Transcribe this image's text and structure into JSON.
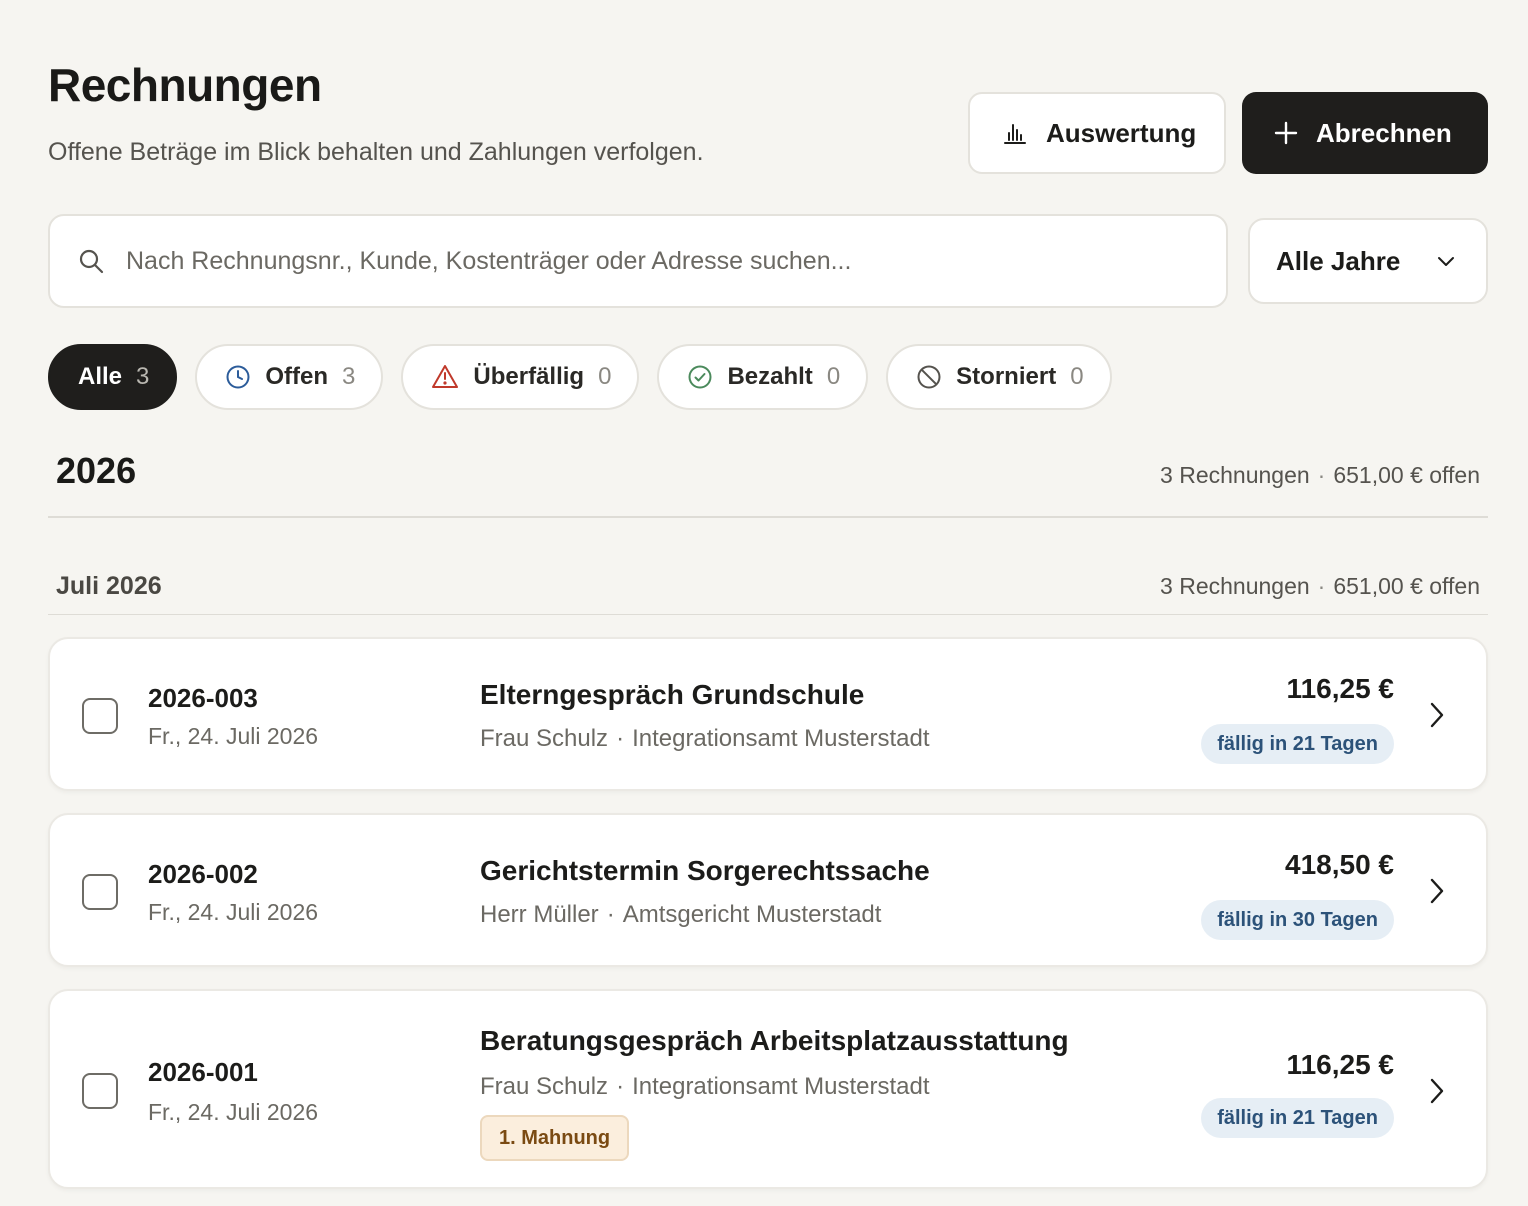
{
  "header": {
    "title": "Rechnungen",
    "subtitle": "Offene Beträge im Blick behalten und Zahlungen verfolgen.",
    "report_label": "Auswertung",
    "create_label": "Abrechnen"
  },
  "search": {
    "placeholder": "Nach Rechnungsnr., Kunde, Kostenträger oder Adresse suchen...",
    "value": ""
  },
  "year_select": {
    "selected": "Alle Jahre"
  },
  "filters": [
    {
      "label": "Alle",
      "count": "3",
      "active": true,
      "icon": "none"
    },
    {
      "label": "Offen",
      "count": "3",
      "active": false,
      "icon": "clock-icon"
    },
    {
      "label": "Überfällig",
      "count": "0",
      "active": false,
      "icon": "warning-icon"
    },
    {
      "label": "Bezahlt",
      "count": "0",
      "active": false,
      "icon": "check-circle-icon"
    },
    {
      "label": "Storniert",
      "count": "0",
      "active": false,
      "icon": "cancel-icon"
    }
  ],
  "year_group": {
    "year": "2026",
    "count_text": "3 Rechnungen",
    "open_text": "651,00 € offen"
  },
  "month_group": {
    "month": "Juli 2026",
    "count_text": "3 Rechnungen",
    "open_text": "651,00 € offen"
  },
  "invoices": [
    {
      "number": "2026-003",
      "date": "Fr., 24. Juli 2026",
      "title": "Elterngespräch Grundschule",
      "client": "Frau Schulz",
      "payer": "Integrationsamt Musterstadt",
      "amount": "116,25 €",
      "due": "fällig in 21 Tagen",
      "reminder": ""
    },
    {
      "number": "2026-002",
      "date": "Fr., 24. Juli 2026",
      "title": "Gerichtstermin Sorgerechtssache",
      "client": "Herr Müller",
      "payer": "Amtsgericht Musterstadt",
      "amount": "418,50 €",
      "due": "fällig in 30 Tagen",
      "reminder": ""
    },
    {
      "number": "2026-001",
      "date": "Fr., 24. Juli 2026",
      "title": "Beratungsgespräch Arbeitsplatzausstattung",
      "client": "Frau Schulz",
      "payer": "Integrationsamt Musterstadt",
      "amount": "116,25 €",
      "due": "fällig in 21 Tagen",
      "reminder": "1. Mahnung"
    }
  ],
  "colors": {
    "background": "#f6f5f1",
    "primary_dark": "#1f1e1c",
    "badge_bg": "#e6eef5",
    "badge_text": "#2c5279",
    "reminder_bg": "#fbeedd",
    "reminder_text": "#7a4a12",
    "warning_icon": "#c0392b",
    "open_icon": "#2c5c9a",
    "paid_icon": "#4b8a5c"
  }
}
